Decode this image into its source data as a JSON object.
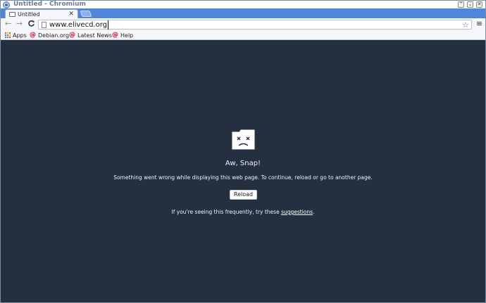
{
  "window": {
    "title": "Untitled - Chromium"
  },
  "window_controls": [
    "⌃",
    "⌄",
    "✕"
  ],
  "tab": {
    "title": "Untitled",
    "close_glyph": "✕"
  },
  "toolbar": {
    "back_glyph": "←",
    "forward_glyph": "→",
    "reload_glyph": "C",
    "url": "www.elivecd.org",
    "star_glyph": "☆",
    "menu_glyph": "≡"
  },
  "bookmarks": [
    {
      "label": "Apps",
      "icon": "apps-grid-icon"
    },
    {
      "label": "Debian.org",
      "icon": "debian-swirl-icon"
    },
    {
      "label": "Latest News",
      "icon": "debian-swirl-icon"
    },
    {
      "label": "Help",
      "icon": "debian-swirl-icon"
    }
  ],
  "content": {
    "title": "Aw, Snap!",
    "message": "Something went wrong while displaying this web page. To continue, reload or go to another page.",
    "reload_label": "Reload",
    "hint_prefix": "If you're seeing this frequently, try these ",
    "hint_link": "suggestions",
    "hint_suffix": "."
  },
  "colors": {
    "tabstrip": "#4f86d8",
    "content_bg": "#243040",
    "debian_red": "#c70036"
  }
}
